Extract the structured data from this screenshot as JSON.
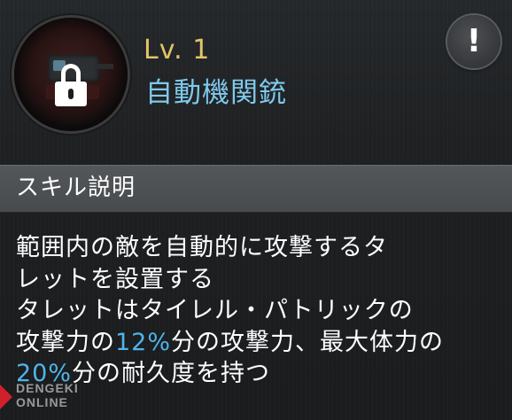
{
  "skill": {
    "level": "Lv. 1",
    "name": "自動機関銃",
    "icon": "locked-turret-icon",
    "locked": true
  },
  "alert_button": {
    "label": "!"
  },
  "section": {
    "title": "スキル説明"
  },
  "description": {
    "line1": "範囲内の敵を自動的に攻撃するタ",
    "line2": "レットを設置する",
    "line3": "タレットはタイレル・パトリックの",
    "line4_pre": "攻撃力の",
    "line4_value": "12%",
    "line4_post": "分の攻撃力、最大体力の",
    "line5_value": "20%",
    "line5_post": "分の耐久度を持つ"
  },
  "watermark": {
    "text_top": "DENGEKI",
    "text_bottom": "ONLINE"
  },
  "colors": {
    "level": "#e5c36a",
    "name": "#7fc9ec",
    "highlight": "#4fb4ea",
    "header_bg": "#4e5154",
    "panel_bg": "#1f2123"
  }
}
